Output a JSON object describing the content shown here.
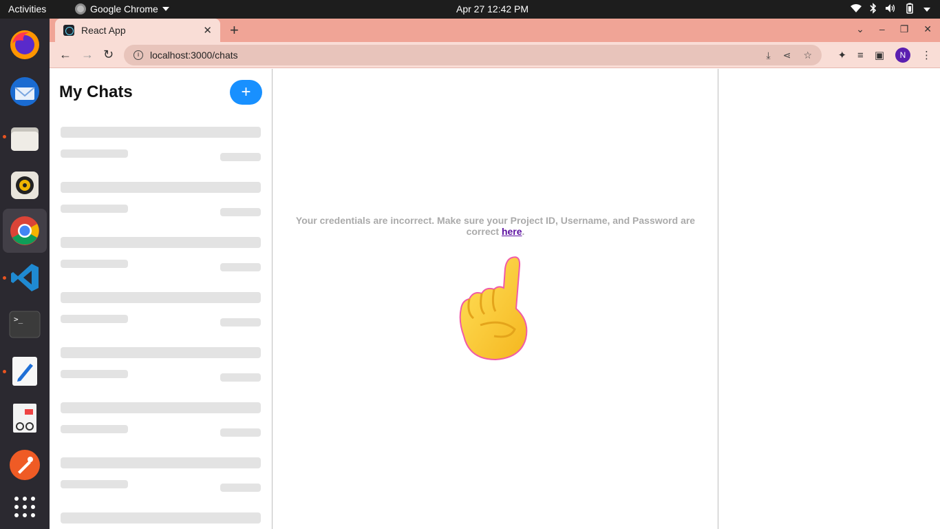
{
  "topbar": {
    "activities": "Activities",
    "app_name": "Google Chrome",
    "clock": "Apr 27  12:42 PM"
  },
  "dock": {
    "apps": [
      {
        "name": "firefox",
        "color": "#ff7139"
      },
      {
        "name": "thunderbird",
        "color": "#1a6bd1"
      },
      {
        "name": "files",
        "color": "#c9c6bf"
      },
      {
        "name": "rhythmbox",
        "color": "#e7e3da"
      },
      {
        "name": "chrome",
        "color": "#4285f4"
      },
      {
        "name": "vscode",
        "color": "#1f8ad2"
      },
      {
        "name": "terminal",
        "color": "#3a3a3a"
      },
      {
        "name": "text-editor",
        "color": "#f5f5f5"
      },
      {
        "name": "document-viewer",
        "color": "#f5f5f5"
      },
      {
        "name": "postman",
        "color": "#ef5b25"
      },
      {
        "name": "app-grid",
        "color": "#2b2930"
      }
    ]
  },
  "browser": {
    "tab_title": "React App",
    "url": "localhost:3000/chats",
    "profile_initial": "N"
  },
  "sidebar": {
    "title": "My Chats",
    "add_label": "+"
  },
  "main": {
    "message": "Your credentials are incorrect. Make sure your Project ID, Username, and Password are correct",
    "link_text": "here",
    "after_link": "."
  }
}
